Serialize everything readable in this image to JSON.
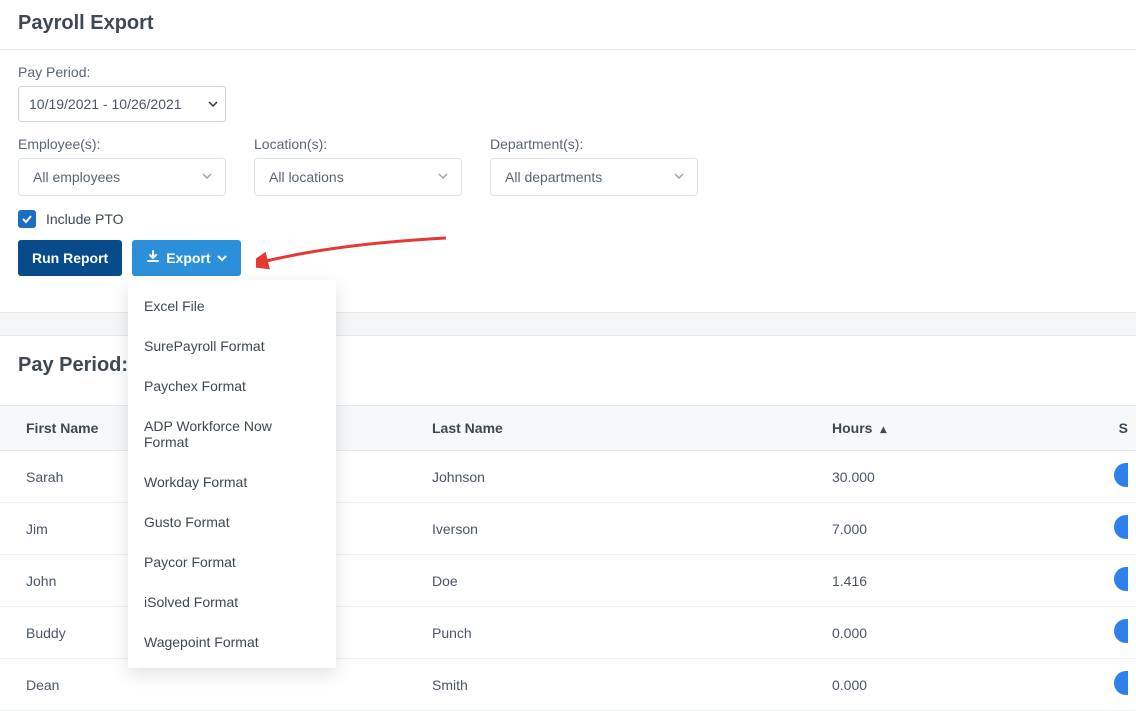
{
  "page": {
    "title": "Payroll Export"
  },
  "filters": {
    "pay_period_label": "Pay Period:",
    "pay_period_value": "10/19/2021 - 10/26/2021",
    "employees_label": "Employee(s):",
    "employees_value": "All employees",
    "locations_label": "Location(s):",
    "locations_value": "All locations",
    "departments_label": "Department(s):",
    "departments_value": "All departments",
    "include_pto_label": "Include PTO",
    "include_pto_checked": true
  },
  "buttons": {
    "run_report": "Run Report",
    "export": "Export"
  },
  "export_menu": [
    "Excel File",
    "SurePayroll Format",
    "Paychex Format",
    "ADP Workforce Now Format",
    "Workday Format",
    "Gusto Format",
    "Paycor Format",
    "iSolved Format",
    "Wagepoint Format"
  ],
  "results": {
    "heading_prefix": "Pay Period: 1",
    "columns": {
      "first": "First Name",
      "last": "Last Name",
      "hours": "Hours",
      "s": "S"
    },
    "rows": [
      {
        "first": "Sarah",
        "last": "Johnson",
        "hours": "30.000"
      },
      {
        "first": "Jim",
        "last": "Iverson",
        "hours": "7.000"
      },
      {
        "first": "John",
        "last": "Doe",
        "hours": "1.416"
      },
      {
        "first": "Buddy",
        "last": "Punch",
        "hours": "0.000"
      },
      {
        "first": "Dean",
        "last": "Smith",
        "hours": "0.000"
      }
    ]
  }
}
